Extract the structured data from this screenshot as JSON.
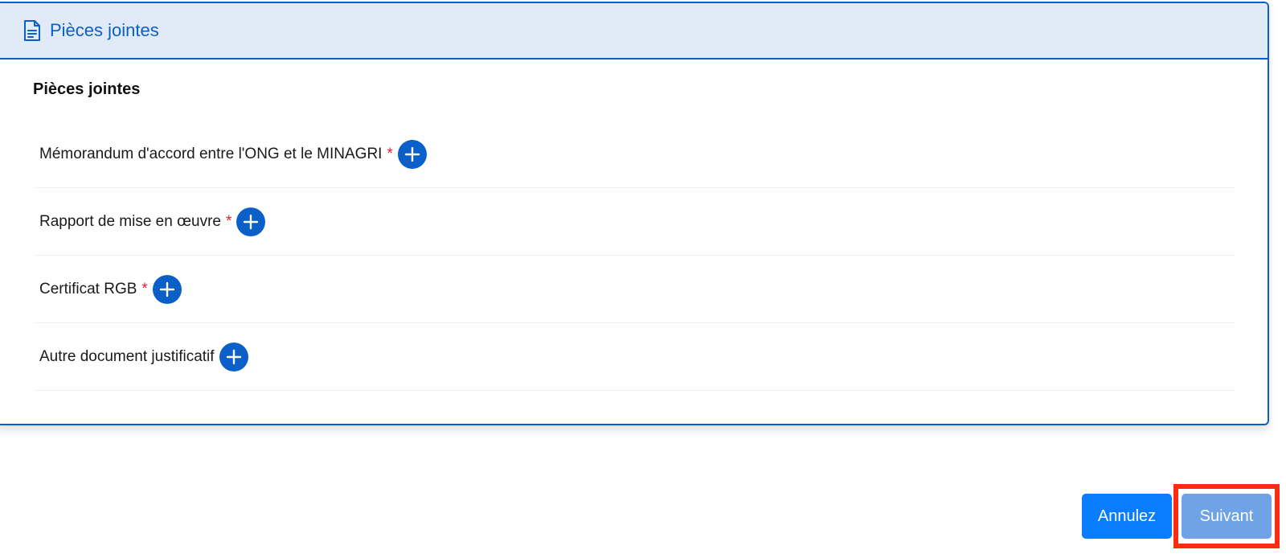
{
  "header": {
    "title": "Pièces jointes",
    "icon": "document-icon"
  },
  "section": {
    "title": "Pièces jointes"
  },
  "attachments": [
    {
      "label": "Mémorandum d'accord entre l'ONG et le MINAGRI",
      "required_mark": "*",
      "action_icon": "plus-circle-icon"
    },
    {
      "label": "Rapport de mise en œuvre",
      "required_mark": "*",
      "action_icon": "plus-circle-icon"
    },
    {
      "label": "Certificat RGB",
      "required_mark": "*",
      "action_icon": "plus-circle-icon"
    },
    {
      "label": "Autre document justificatif",
      "required_mark": "",
      "action_icon": "plus-circle-icon"
    }
  ],
  "footer": {
    "cancel_label": "Annulez",
    "next_label": "Suivant"
  },
  "colors": {
    "accent": "#0a5fc9",
    "header_bg": "#e0ebf7",
    "required": "#e0223b",
    "cancel_button": "#0a7cff",
    "next_button": "#6fa3e6",
    "highlight": "#ff2a12"
  }
}
